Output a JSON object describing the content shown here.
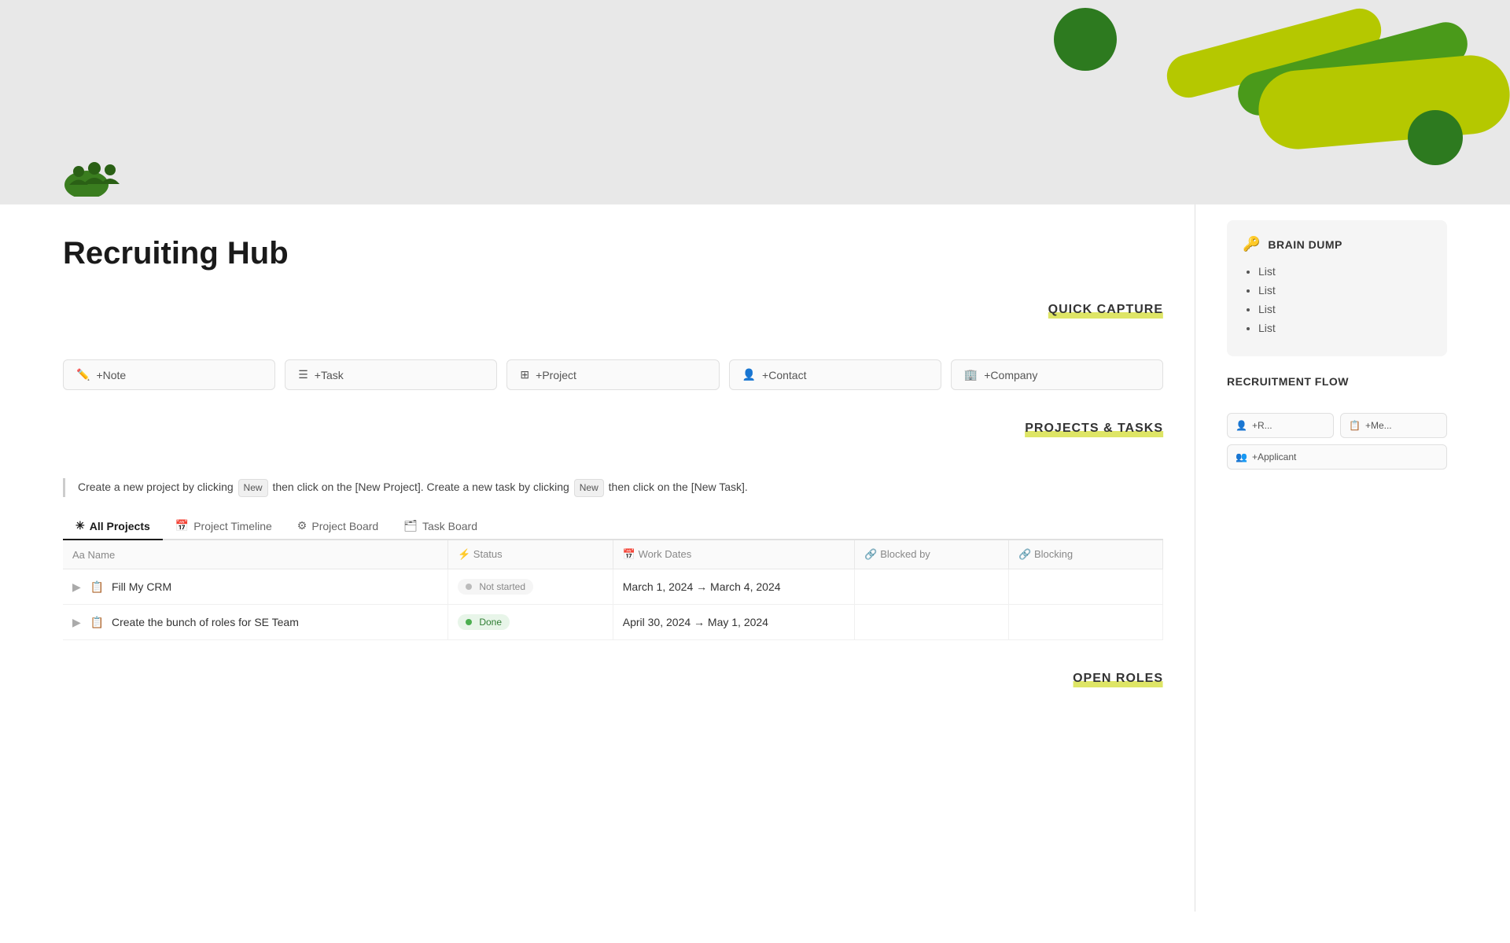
{
  "page": {
    "title": "Recruiting Hub",
    "header_bg": "#e8e8e8"
  },
  "sections": {
    "quick_capture": "QUICK CAPTURE",
    "projects_tasks": "PROJECTS & TASKS",
    "open_roles": "OPEN ROLES"
  },
  "quick_capture_buttons": [
    {
      "id": "note",
      "label": "+Note",
      "icon": "✏️"
    },
    {
      "id": "task",
      "label": "+Task",
      "icon": "☰"
    },
    {
      "id": "project",
      "label": "+Project",
      "icon": "⊞"
    },
    {
      "id": "contact",
      "label": "+Contact",
      "icon": "👤"
    },
    {
      "id": "company",
      "label": "+Company",
      "icon": "🏢"
    }
  ],
  "instruction": {
    "text_1": "Create a new project by clicking",
    "badge_1": "New",
    "text_2": "then click on the [New Project]. Create a new task by clicking",
    "badge_2": "New",
    "text_3": "then click on the [New Task]."
  },
  "tabs": [
    {
      "id": "all-projects",
      "label": "All Projects",
      "icon": "✳",
      "active": true
    },
    {
      "id": "project-timeline",
      "label": "Project Timeline",
      "icon": "📅",
      "active": false
    },
    {
      "id": "project-board",
      "label": "Project Board",
      "icon": "⚙",
      "active": false
    },
    {
      "id": "task-board",
      "label": "Task Board",
      "icon": "🗂",
      "active": false
    }
  ],
  "table": {
    "headers": [
      {
        "id": "name",
        "label": "Name",
        "icon": "Aa"
      },
      {
        "id": "status",
        "label": "Status",
        "icon": "⚡"
      },
      {
        "id": "work_dates",
        "label": "Work Dates",
        "icon": "📅"
      },
      {
        "id": "blocked_by",
        "label": "Blocked by",
        "icon": "🔗"
      },
      {
        "id": "blocking",
        "label": "Blocking",
        "icon": "🔗"
      }
    ],
    "rows": [
      {
        "id": "row-1",
        "name": "Fill My CRM",
        "name_icon": "📋",
        "status": "Not started",
        "status_type": "not-started",
        "work_dates": "March 1, 2024 → March 4, 2024",
        "blocked_by": "",
        "blocking": ""
      },
      {
        "id": "row-2",
        "name": "Create the bunch of roles for SE Team",
        "name_icon": "📋",
        "status": "Done",
        "status_type": "done",
        "work_dates": "April 30, 2024 → May 1, 2024",
        "blocked_by": "",
        "blocking": ""
      }
    ]
  },
  "brain_dump": {
    "title": "BRAIN DUMP",
    "icon": "🔑",
    "items": [
      "List",
      "List",
      "List",
      "List"
    ]
  },
  "recruitment_flow": {
    "title": "RECRUITMENT FLOW",
    "buttons": [
      {
        "id": "add-role",
        "label": "+R...",
        "icon": "👤"
      },
      {
        "id": "add-meeting",
        "label": "+Me...",
        "icon": "📋"
      },
      {
        "id": "add-applicant",
        "label": "+Applicant",
        "icon": "👥"
      }
    ]
  },
  "colors": {
    "accent_yellow_green": "#c8d400",
    "dark_green": "#2d7a1f",
    "medium_green": "#4a9a1a",
    "done_green": "#4caf50",
    "tab_active_border": "#1a1a1a"
  }
}
